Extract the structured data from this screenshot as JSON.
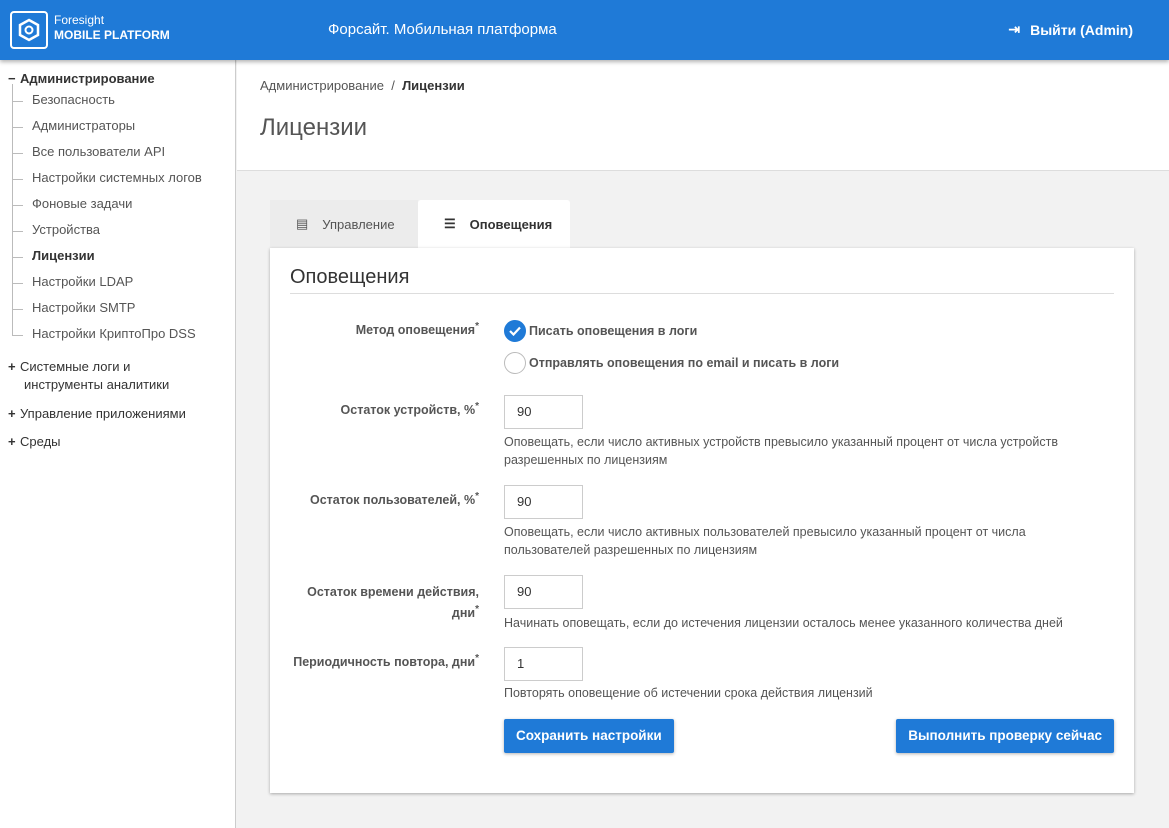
{
  "header": {
    "brand_line1": "Foresight",
    "brand_line2": "MOBILE PLATFORM",
    "app_title": "Форсайт. Мобильная платформа",
    "logout": "Выйти (Admin)"
  },
  "sidebar": {
    "admin": "Администрирование",
    "items": [
      "Безопасность",
      "Администраторы",
      "Все пользователи API",
      "Настройки системных логов",
      "Фоновые задачи",
      "Устройства",
      "Лицензии",
      "Настройки LDAP",
      "Настройки SMTP",
      "Настройки КриптоПро DSS"
    ],
    "groups": [
      "Системные логи и",
      "инструменты аналитики",
      "Управление приложениями",
      "Среды"
    ]
  },
  "breadcrumb": {
    "parent": "Администрирование",
    "sep": "/",
    "current": "Лицензии"
  },
  "page_title": "Лицензии",
  "tabs": [
    "Управление",
    "Оповещения"
  ],
  "form": {
    "title": "Оповещения",
    "method_label": "Метод оповещения",
    "req": "*",
    "options": [
      "Писать оповещения в логи",
      "Отправлять оповещения по email и писать в логи"
    ],
    "selected_option": 0,
    "fields": [
      {
        "label": "Остаток устройств, %",
        "value": "90",
        "hint": "Оповещать, если число активных устройств превысило указанный процент от числа устройств разрешенных по лицензиям"
      },
      {
        "label": "Остаток пользователей, %",
        "value": "90",
        "hint": "Оповещать, если число активных пользователей превысило указанный процент от числа пользователей разрешенных по лицензиям"
      },
      {
        "label": "Остаток времени действия,",
        "label2": "дни",
        "value": "90",
        "hint": "Начинать оповещать, если до истечения лицензии осталось менее указанного количества дней"
      },
      {
        "label": "Периодичность повтора, дни",
        "value": "1",
        "hint": "Повторять оповещение об истечении срока действия лицензий"
      }
    ],
    "save": "Сохранить настройки",
    "check": "Выполнить проверку сейчас"
  }
}
